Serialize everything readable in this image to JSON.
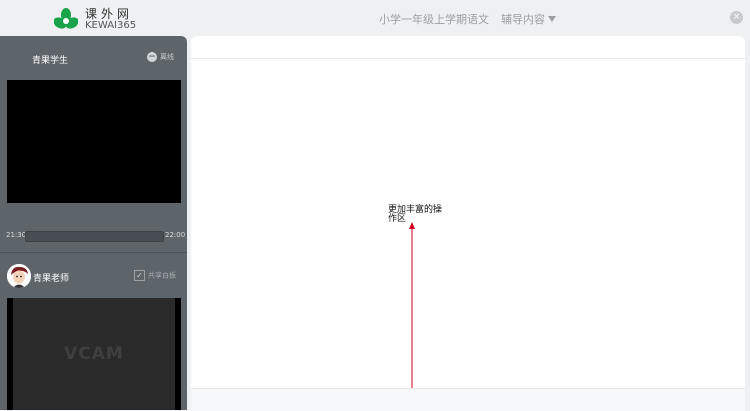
{
  "header": {
    "logo_cn": "课外网",
    "logo_en": "KEWAI365",
    "course_title": "小学一年级上学期语文",
    "assist_menu_label": "辅导内容",
    "close_icon": "×"
  },
  "left_panel": {
    "student": {
      "name": "青果学生",
      "status": "离线",
      "status_icon": "−"
    },
    "timeline": {
      "start": "21:30",
      "end": "22:00",
      "progress": 0.0
    },
    "teacher": {
      "name": "青果老师",
      "share_whiteboard_label": "共享白板",
      "share_whiteboard_checked": true,
      "check_mark": "✓"
    },
    "video_placeholder": "VCAM"
  },
  "main": {
    "annotation_text": "更加丰富的操作区",
    "annotation_color": "#d0021b"
  },
  "colors": {
    "brand_green": "#1aa34a",
    "panel_bg": "#5d656b",
    "header_bg": "#eef0f1"
  }
}
